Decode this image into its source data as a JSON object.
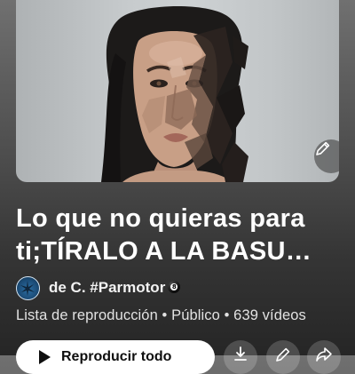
{
  "playlist": {
    "title_line1": "Lo que no quieras para",
    "title_line2": "ti;TÍRALO A LA BASU…",
    "owner": "de C. #Parmotor",
    "meta": "Lista de reproducción • Público • 639 vídeos"
  },
  "actions": {
    "play_all_label": "Reproducir todo",
    "edit_icon": "pencil-icon",
    "download_icon": "download-icon",
    "edit_details_icon": "pencil-icon",
    "share_icon": "share-icon"
  },
  "colors": {
    "background_top": "#707070",
    "background_bottom": "#262626",
    "button_bg": "#ffffff",
    "button_text": "#0f0f0f"
  }
}
